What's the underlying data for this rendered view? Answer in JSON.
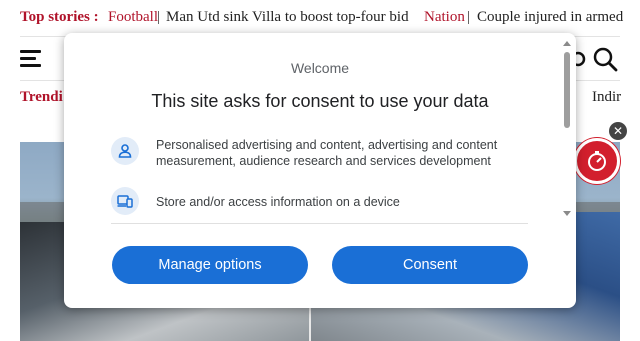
{
  "ticker": {
    "label": "Top stories :",
    "items": [
      {
        "category": "Football",
        "separator": "|",
        "headline": "Man Utd sink Villa to boost top-four bid"
      },
      {
        "category": "Nation",
        "separator": "|",
        "headline": "Couple injured in armed"
      }
    ]
  },
  "trending": {
    "label": "Trendi",
    "right_text": "Indir"
  },
  "consent": {
    "welcome": "Welcome",
    "title": "This site asks for consent to use your data",
    "purposes": [
      {
        "icon": "person-icon",
        "text": "Personalised advertising and content, advertising and content measurement, audience research and services development"
      },
      {
        "icon": "devices-icon",
        "text": "Store and/or access information on a device"
      }
    ],
    "manage_label": "Manage options",
    "consent_label": "Consent"
  },
  "ad": {
    "close_symbol": "✕"
  },
  "colors": {
    "accent_red": "#b0132a",
    "button_blue": "#1a6fd6",
    "icon_bg": "#e2ecf8"
  }
}
